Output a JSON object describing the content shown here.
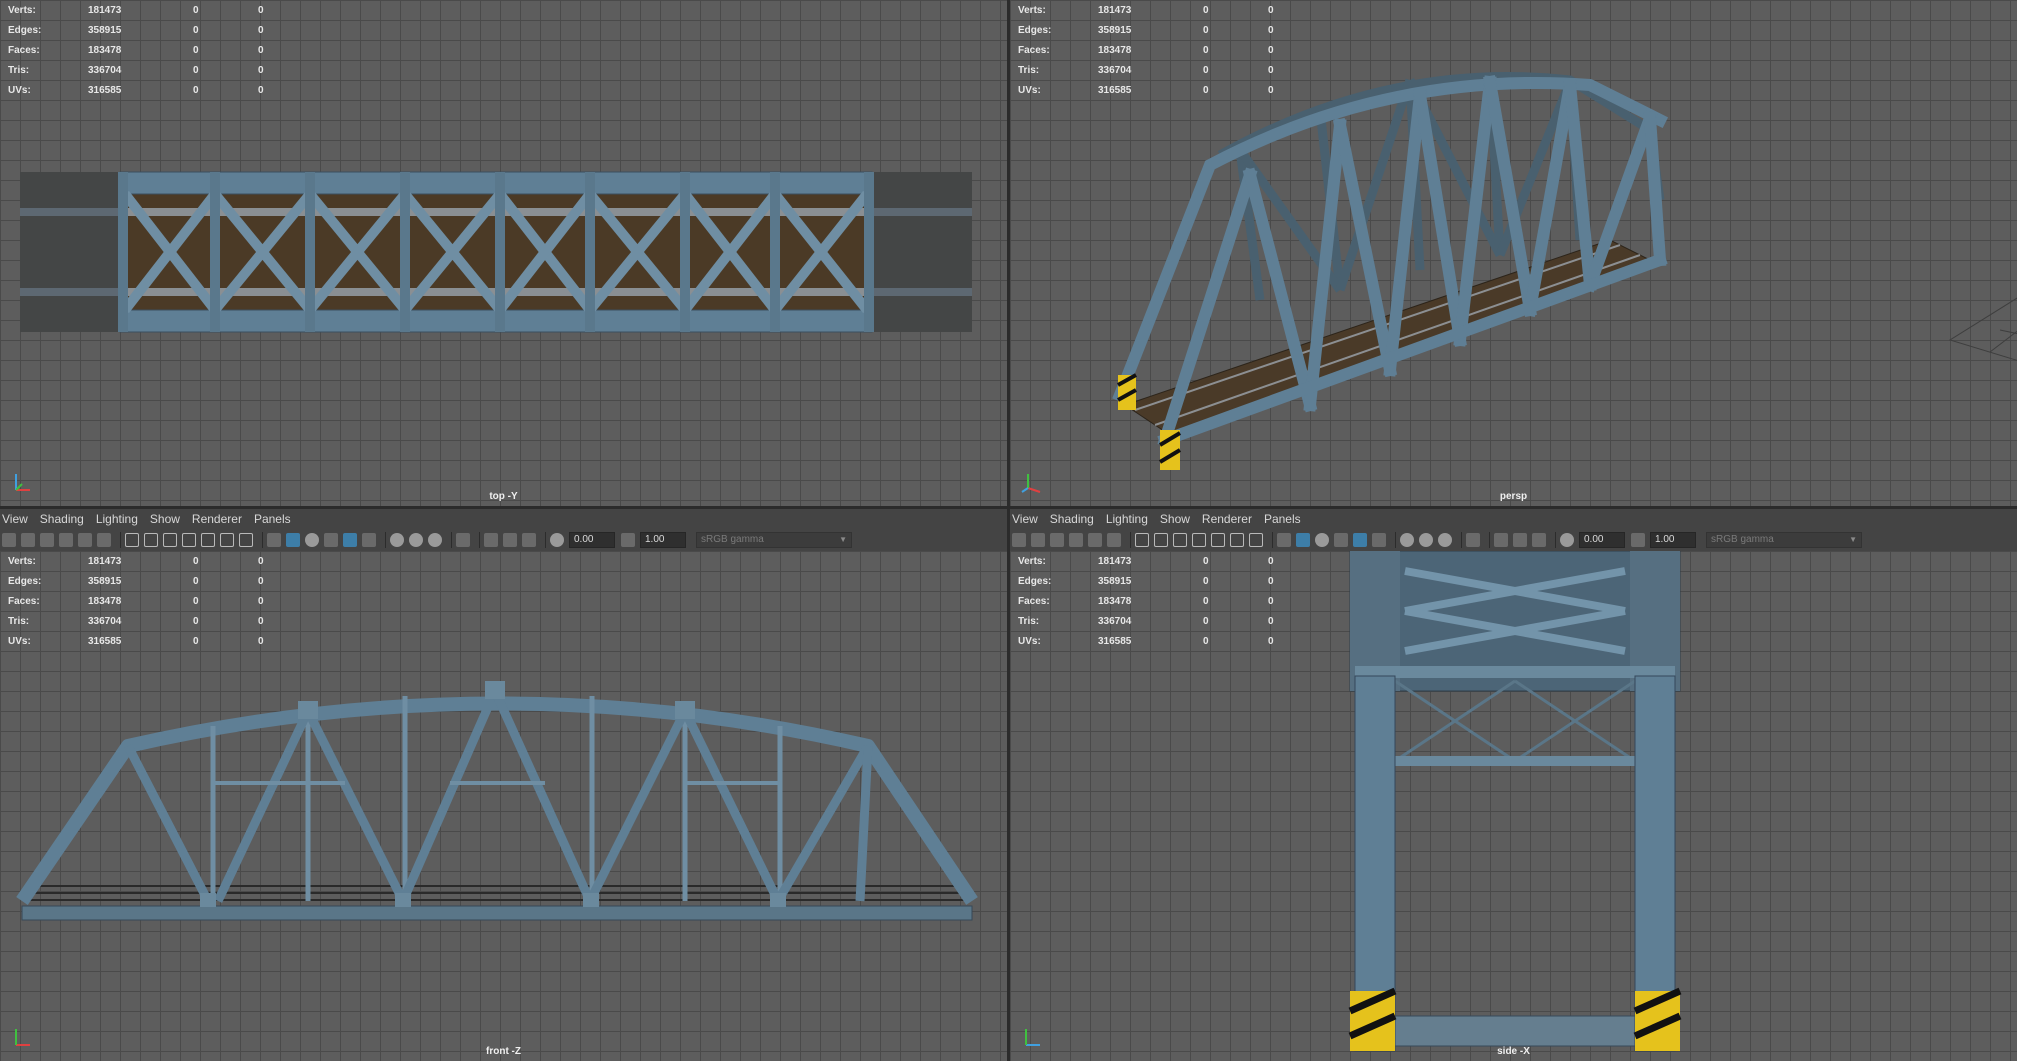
{
  "stats": {
    "rows": [
      {
        "label": "Verts:",
        "v1": "181473",
        "v2": "0",
        "v3": "0"
      },
      {
        "label": "Edges:",
        "v1": "358915",
        "v2": "0",
        "v3": "0"
      },
      {
        "label": "Faces:",
        "v1": "183478",
        "v2": "0",
        "v3": "0"
      },
      {
        "label": "Tris:",
        "v1": "336704",
        "v2": "0",
        "v3": "0"
      },
      {
        "label": "UVs:",
        "v1": "316585",
        "v2": "0",
        "v3": "0"
      }
    ]
  },
  "viewports": {
    "top": {
      "label": "top -Y"
    },
    "persp": {
      "label": "persp"
    },
    "front": {
      "label": "front -Z"
    },
    "side": {
      "label": "side -X"
    }
  },
  "panel_menu": {
    "view": "View",
    "shading": "Shading",
    "lighting": "Lighting",
    "show": "Show",
    "renderer": "Renderer",
    "panels": "Panels"
  },
  "toolbar": {
    "exposure": "0.00",
    "gamma": "1.00",
    "colorspace": "sRGB gamma"
  },
  "colors": {
    "viewport_bg": "#5d5d5d",
    "grid_line": "#4a4a4a",
    "steel_blue": "#5f7f95",
    "deck_brown": "#4b3a26",
    "hazard_yellow": "#e5c21c"
  }
}
